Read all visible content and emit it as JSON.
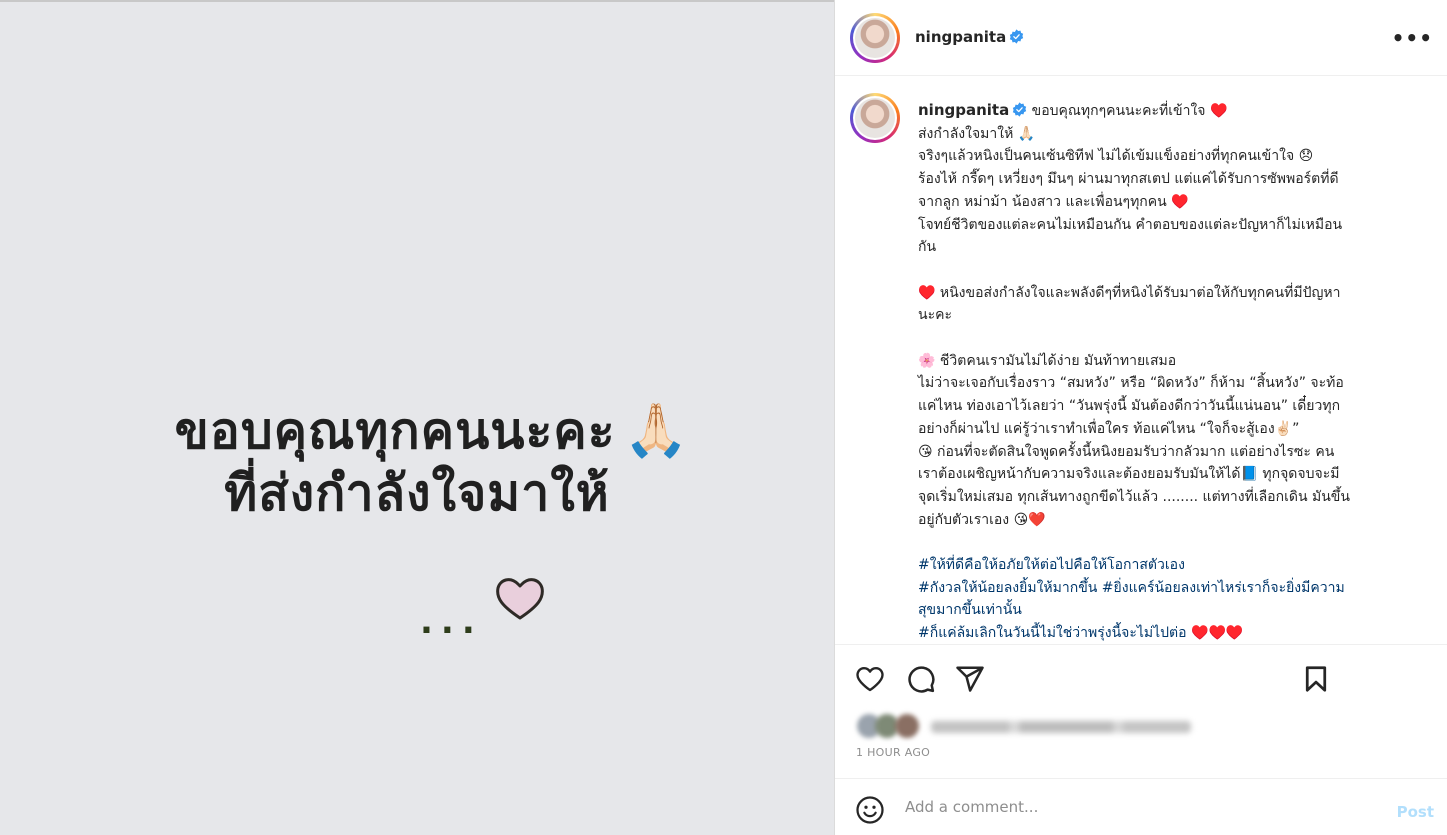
{
  "media": {
    "line1": "ขอบคุณทุกคนนะคะ",
    "line1_emoji": "🙏🏻",
    "line2": "ที่ส่งกำลังใจมาให้",
    "dots": "...",
    "heart": "♡"
  },
  "header": {
    "username": "ningpanita",
    "more": "•••"
  },
  "caption": {
    "username": "ningpanita",
    "lines": [
      "ขอบคุณทุกๆคนนะคะที่เข้าใจ ♥️",
      "ส่งกำลังใจมาให้ 🙏🏻",
      "จริงๆแล้วหนิงเป็นคนเซ้นซิทีฟ ไม่ได้เข้มแข็งอย่างที่ทุกคนเข้าใจ 😞",
      "ร้องไห้ กรี๊ดๆ เหวี่ยงๆ มึนๆ ผ่านมาทุกสเตป แต่แค่ได้รับการซัพพอร์ตที่ดี",
      "จากลูก หม่าม้า น้องสาว และเพื่อนๆทุกคน ♥️",
      "โจทย์ชีวิตของแต่ละคนไม่เหมือนกัน คำตอบของแต่ละปัญหาก็ไม่เหมือน",
      "กัน",
      "",
      "♥️ หนิงขอส่งกำลังใจและพลังดีๆที่หนิงได้รับมาต่อให้กับทุกคนที่มีปัญหา",
      "นะคะ",
      "",
      "🌸 ชีวิตคนเรามันไม่ได้ง่าย มันท้าทายเสมอ",
      "ไม่ว่าจะเจอกับเรื่องราว “สมหวัง” หรือ “ผิดหวัง” ก็ห้าม “สิ้นหวัง” จะท้อ",
      "แค่ไหน ท่องเอาไว้เลยว่า “วันพรุ่งนี้ มันต้องดีกว่าวันนี้แน่นอน” เดี๋ยวทุก",
      "อย่างก็ผ่านไป แค่รู้ว่าเราทำเพื่อใคร ท้อแค่ไหน “ใจก็จะสู้เอง✌🏻”",
      "😘 ก่อนที่จะตัดสินใจพูดครั้งนี้หนิงยอมรับว่ากลัวมาก แต่อย่างไรซะ คน",
      "เราต้องเผชิญหน้ากับความจริงและต้องยอมรับมันให้ได้📘 ทุกจุดจบจะมี",
      "จุดเริ่มใหม่เสมอ ทุกเส้นทางถูกขีดไว้แล้ว ........ แต่ทางที่เลือกเดิน มันขึ้น",
      "อยู่กับตัวเราเอง 😘❤️"
    ],
    "hashtag_lines": [
      "#ให้ที่ดีคือให้อภัยให้ต่อไปคือให้โอกาสตัวเอง",
      "#กังวลให้น้อยลงยิ้มให้มากขึ้น #ยิ่งแคร์น้อยลงเท่าไหร่เราก็จะยิ่งมีความ",
      "สุขมากขึ้นเท่านั้น",
      "#ก็แค่ล้มเลิกในวันนี้ไม่ใช่ว่าพรุ่งนี้จะไม่ไปต่อ"
    ],
    "last_hearts": " ♥️♥️♥️"
  },
  "actions": {
    "like": "heart-icon",
    "comment": "comment-icon",
    "share": "send-icon",
    "save": "bookmark-icon"
  },
  "likes": {
    "text_blurred": true
  },
  "time": "1 HOUR AGO",
  "comment": {
    "placeholder": "Add a comment...",
    "post_label": "Post"
  },
  "colors": {
    "verified": "#3897f0",
    "hashtag": "#00376b",
    "post_disabled": "#b2dffc",
    "media_bg": "#e6e7ea"
  }
}
